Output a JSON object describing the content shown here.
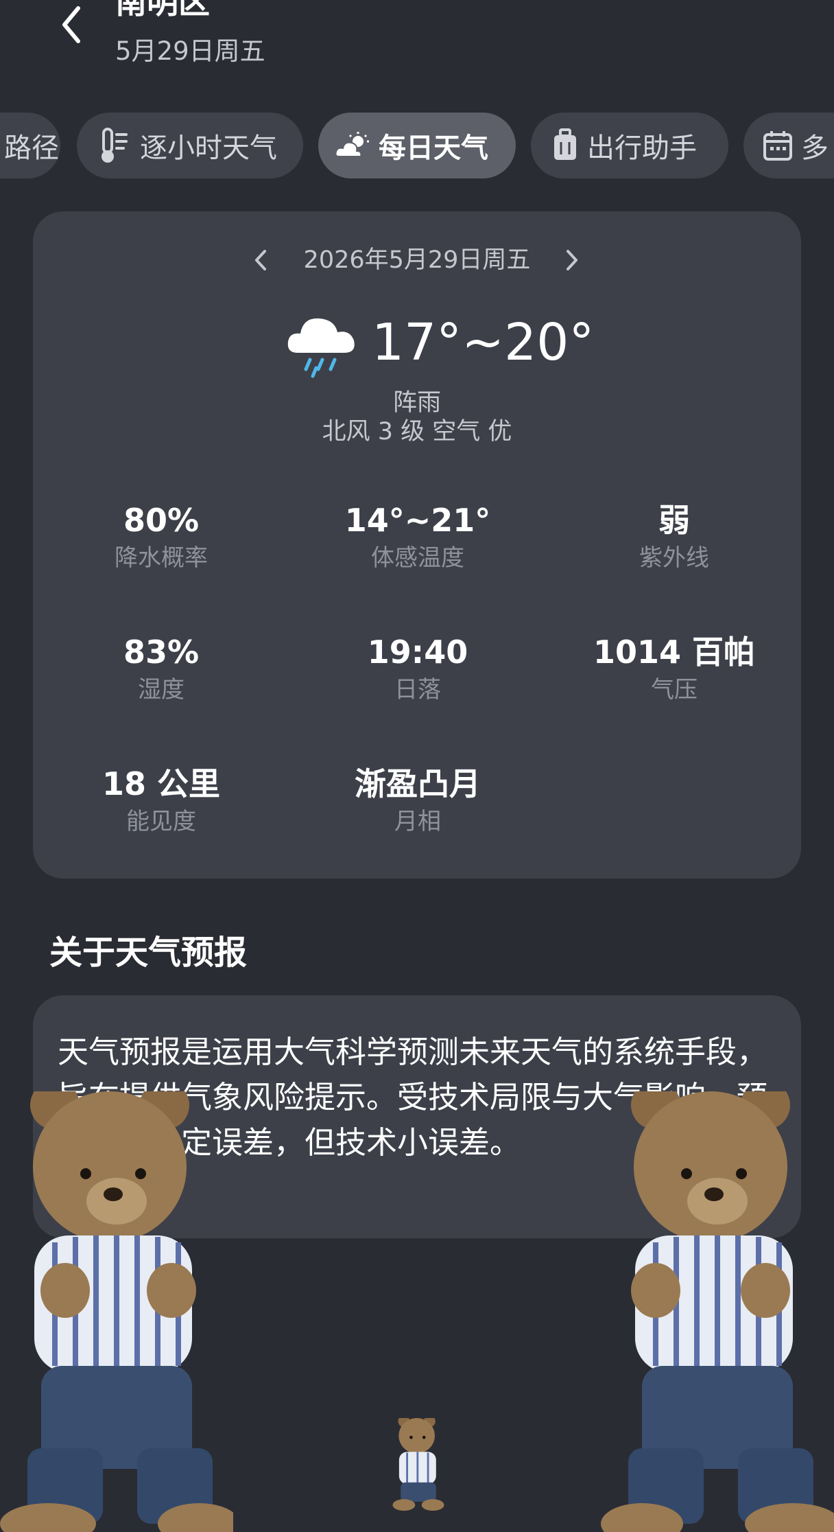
{
  "header": {
    "title": "南明区",
    "subtitle": "5月29日周五"
  },
  "tabs": [
    {
      "label": "路径",
      "icon": "route-icon"
    },
    {
      "label": "逐小时天气",
      "icon": "thermometer-icon"
    },
    {
      "label": "每日天气",
      "icon": "partly-cloudy-icon",
      "active": true
    },
    {
      "label": "出行助手",
      "icon": "luggage-icon"
    },
    {
      "label": "多",
      "icon": "calendar-icon"
    }
  ],
  "daily": {
    "date": "2026年5月29日周五",
    "temp_range": "17°~20°",
    "condition": "阵雨",
    "wind_air": "北风 3 级 空气 优",
    "weather_icon": "rain-cloud-icon",
    "metrics": [
      {
        "value": "80%",
        "label": "降水概率"
      },
      {
        "value": "14°~21°",
        "label": "体感温度"
      },
      {
        "value": "弱",
        "label": "紫外线"
      },
      {
        "value": "83%",
        "label": "湿度"
      },
      {
        "value": "19:40",
        "label": "日落"
      },
      {
        "value": "1014 百帕",
        "label": "气压"
      },
      {
        "value": "18 公里",
        "label": "能见度"
      },
      {
        "value": "渐盈凸月",
        "label": "月相"
      }
    ]
  },
  "about": {
    "title": "关于天气预报",
    "text": "天气预报是运用大气科学预测未来天气的系统手段，旨在提供气象风险提示。受技术局限与大气影响，预报存在一定误差，但技术小误差。"
  },
  "colors": {
    "background": "#2a2c33",
    "card": "#3d4049",
    "tab": "#3f424b",
    "tab_active": "#5d6069",
    "rain": "#4fb8e8"
  }
}
